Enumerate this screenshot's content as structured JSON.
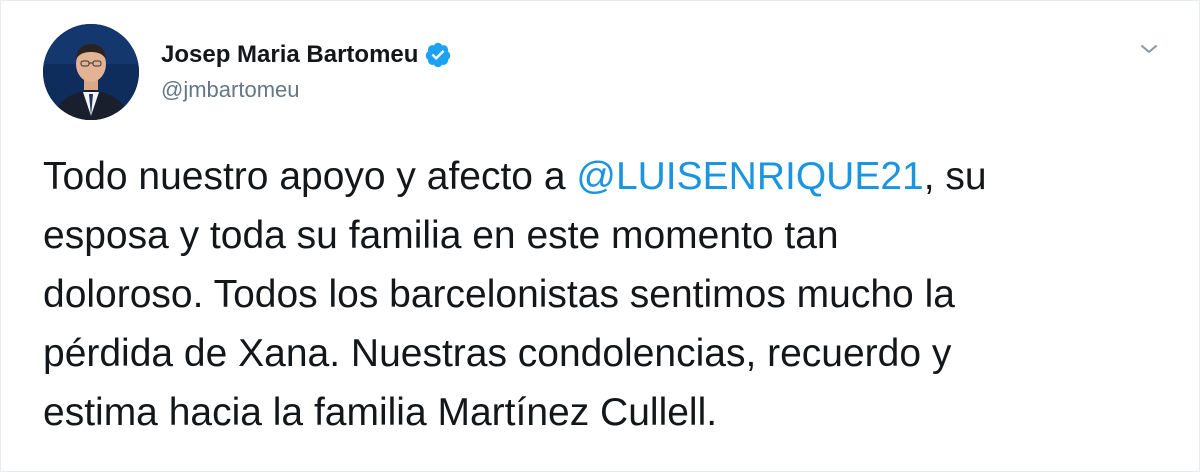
{
  "author": {
    "display_name": "Josep Maria Bartomeu",
    "handle": "@jmbartomeu",
    "verified": true
  },
  "tweet": {
    "line1_before": "Todo nuestro apoyo y afecto a ",
    "mention": "@LUISENRIQUE21",
    "line1_after": ", su",
    "line2": "esposa y toda su familia en este momento tan",
    "line3": "doloroso. Todos los barcelonistas sentimos mucho la",
    "line4": "pérdida de Xana. Nuestras condolencias, recuerdo y",
    "line5": "estima hacia la familia Martínez Cullell."
  },
  "icons": {
    "verified": "verified-badge-icon",
    "menu": "chevron-down-icon"
  },
  "colors": {
    "text": "#14171a",
    "handle": "#657786",
    "link": "#1b95e0",
    "verified": "#1da1f2"
  }
}
